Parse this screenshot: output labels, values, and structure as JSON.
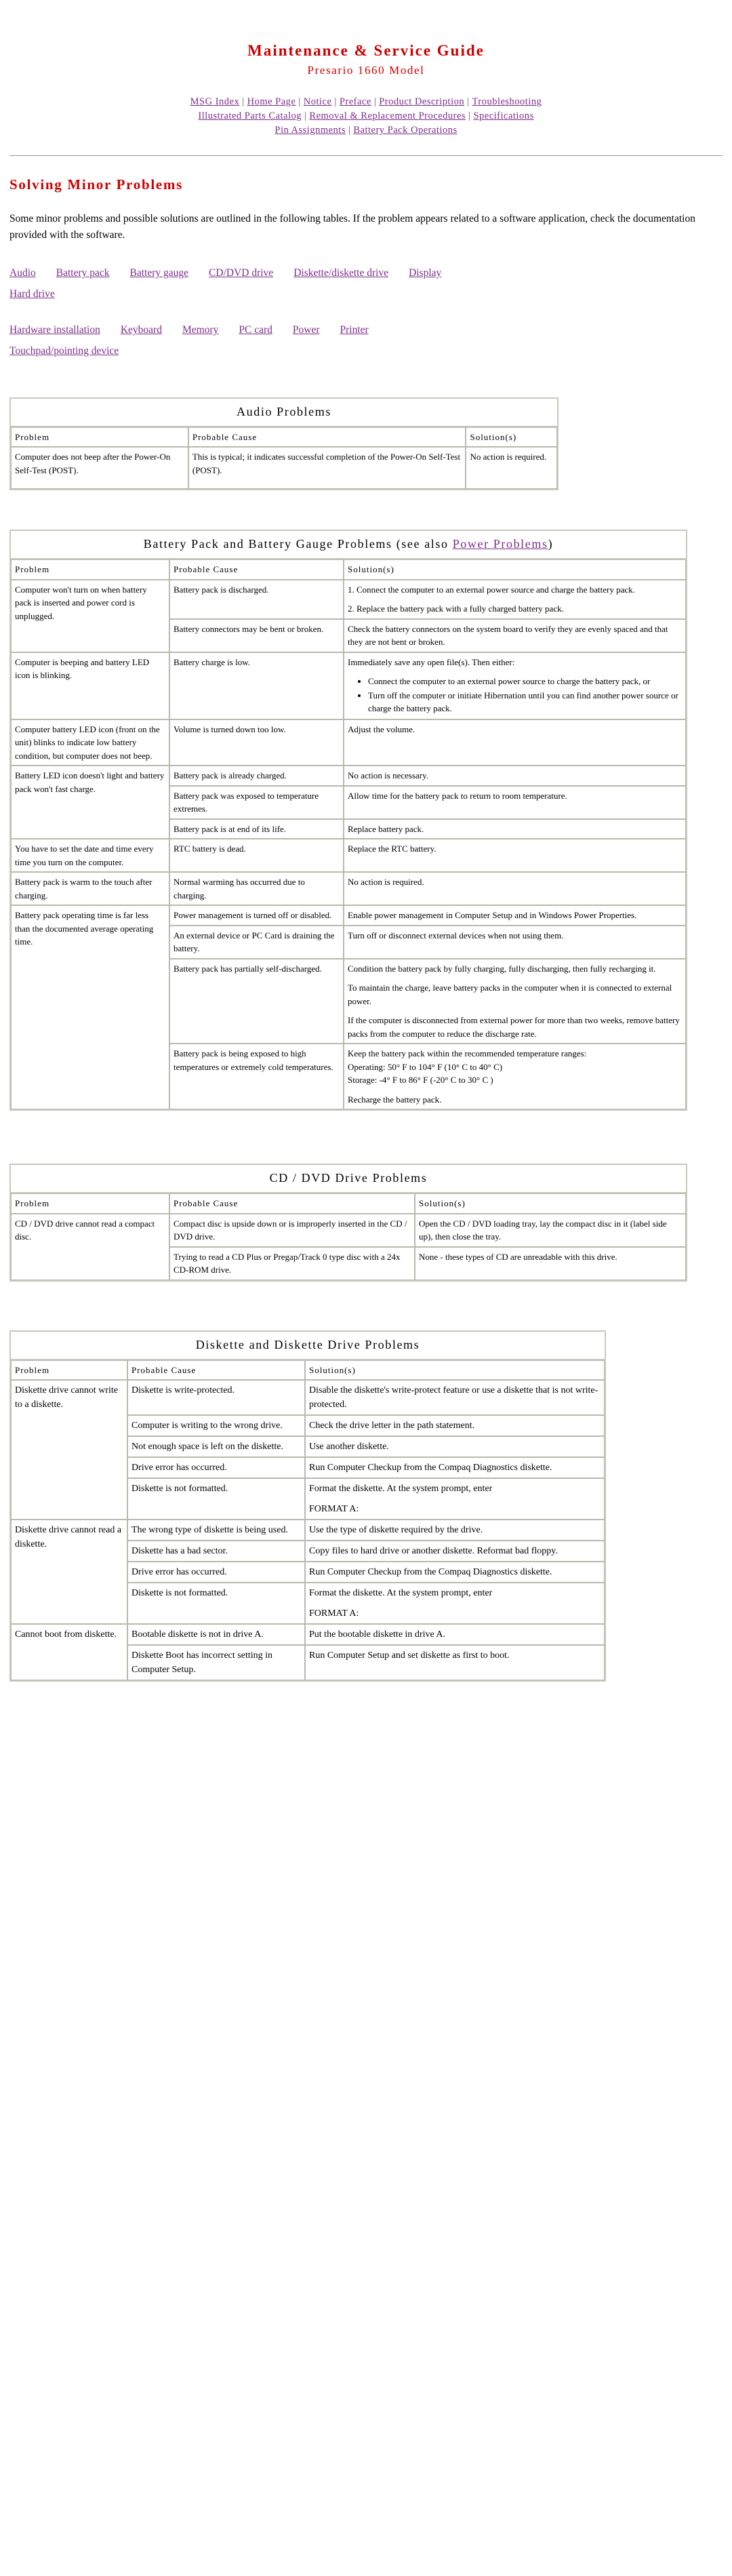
{
  "header": {
    "title": "Maintenance & Service Guide",
    "subtitle": "Presario 1660 Model",
    "nav_line1": [
      {
        "label": "MSG Index"
      },
      {
        "label": "Home Page"
      },
      {
        "label": "Notice"
      },
      {
        "label": "Preface"
      },
      {
        "label": "Product Description"
      },
      {
        "label": "Troubleshooting"
      }
    ],
    "nav_line2": [
      {
        "label": "Illustrated Parts Catalog"
      },
      {
        "label": "Removal & Replacement Procedures"
      },
      {
        "label": "Specifications"
      }
    ],
    "nav_line3": [
      {
        "label": "Pin Assignments"
      },
      {
        "label": "Battery Pack Operations"
      }
    ],
    "separator": "|"
  },
  "section": {
    "heading": "Solving Minor Problems",
    "intro": "Some minor problems and possible solutions are outlined in the following tables. If the problem appears related to a software application, check the documentation provided with the software.",
    "topics_row1": [
      "Audio",
      "Battery pack",
      "Battery gauge",
      "CD/DVD drive",
      "Diskette/diskette drive",
      "Display"
    ],
    "topics_row2": [
      "Hard drive"
    ],
    "topics_row3": [
      "Hardware installation",
      "Keyboard",
      "Memory",
      "PC card",
      "Power",
      "Printer"
    ],
    "topics_row4": [
      "Touchpad/pointing device"
    ]
  },
  "columns": {
    "problem": "Problem",
    "cause": "Probable Cause",
    "solution": "Solution(s)"
  },
  "audio_table": {
    "caption": "Audio Problems",
    "rows": [
      {
        "problem": "Computer does not beep after the Power-On Self-Test (POST).",
        "cause": "This is typical; it indicates successful completion of the Power-On Self-Test (POST).",
        "solution": "No action is required."
      }
    ]
  },
  "battery_table": {
    "caption_pre": "Battery Pack and Battery Gauge Problems (see also ",
    "caption_link": "Power Problems",
    "caption_post": ")",
    "groups": [
      {
        "problem": "Computer won't turn on when battery pack is inserted and power cord is unplugged.",
        "rows": [
          {
            "cause": "Battery pack is discharged.",
            "solution_paras": [
              "1. Connect the computer to an external power source and charge the battery pack.",
              "2. Replace the battery pack with a fully charged battery pack."
            ]
          },
          {
            "cause": "Battery connectors may be bent or broken.",
            "solution_paras": [
              "Check the battery connectors on the system board to verify they are evenly spaced and that they are not bent or broken."
            ]
          }
        ]
      },
      {
        "problem": "Computer is beeping and battery LED icon is blinking.",
        "rows": [
          {
            "cause": "Battery charge is low.",
            "solution_paras": [
              "Immediately save any open file(s). Then either:"
            ],
            "solution_bullets": [
              "Connect the computer to an external power source to charge the battery pack, or",
              "Turn off the computer or initiate Hibernation until you can find another power source or charge the battery pack."
            ]
          }
        ]
      },
      {
        "problem": "Computer battery LED icon (front on the unit) blinks to indicate low battery condition, but computer does not beep.",
        "rows": [
          {
            "cause": "Volume is turned down too low.",
            "solution_paras": [
              "Adjust the volume."
            ]
          }
        ]
      },
      {
        "problem": "Battery LED icon doesn't light and battery pack won't fast charge.",
        "rows": [
          {
            "cause": "Battery pack is already charged.",
            "solution_paras": [
              "No action is necessary."
            ]
          },
          {
            "cause": "Battery pack was exposed to temperature extremes.",
            "solution_paras": [
              "Allow time for the battery pack to return to room temperature."
            ]
          },
          {
            "cause": "Battery pack is at end of its life.",
            "solution_paras": [
              "Replace battery pack."
            ]
          }
        ]
      },
      {
        "problem": "You have to set the date and time every time you turn on the computer.",
        "rows": [
          {
            "cause": "RTC battery is dead.",
            "solution_paras": [
              "Replace the RTC battery."
            ]
          }
        ]
      },
      {
        "problem": "Battery pack is warm to the touch after charging.",
        "rows": [
          {
            "cause": "Normal warming has occurred due to charging.",
            "solution_paras": [
              "No action is required."
            ]
          }
        ]
      },
      {
        "problem": "Battery pack operating time is far less than the documented average operating time.",
        "rows": [
          {
            "cause": "Power management is turned off or disabled.",
            "solution_paras": [
              "Enable power management in Computer Setup and in Windows Power Properties."
            ]
          },
          {
            "cause": "An external device or PC Card is draining the battery.",
            "solution_paras": [
              "Turn off or disconnect external devices when not using them."
            ]
          },
          {
            "cause": "Battery pack has partially self-discharged.",
            "solution_paras": [
              "Condition the battery pack by fully charging, fully discharging, then fully recharging it.",
              "To maintain the charge, leave battery packs in the computer when it is connected to external power.",
              "If the computer is disconnected from external power for more than two weeks, remove battery packs from the computer to reduce the discharge rate."
            ]
          },
          {
            "cause": "Battery pack is being exposed to high temperatures or extremely cold temperatures.",
            "solution_paras": [
              "Keep the battery pack within the recommended temperature ranges:",
              "Operating: 50° F to 104° F (10° C to 40° C)",
              "Storage: -4° F to 86° F (-20° C to 30° C )",
              "Recharge the battery pack."
            ]
          }
        ]
      }
    ]
  },
  "cddvd_table": {
    "caption": "CD / DVD Drive Problems",
    "groups": [
      {
        "problem": "CD / DVD drive cannot read a compact disc.",
        "rows": [
          {
            "cause": "Compact disc is upside down or is improperly inserted in the CD / DVD drive.",
            "solution": "Open the CD / DVD loading tray, lay the compact disc in it (label side up), then close the tray."
          },
          {
            "cause": "Trying to read a CD Plus or Pregap/Track 0 type disc with a 24x CD-ROM drive.",
            "solution": "None - these types of CD are unreadable with this drive."
          }
        ]
      }
    ]
  },
  "diskette_table": {
    "caption": "Diskette and Diskette Drive Problems",
    "groups": [
      {
        "problem": "Diskette drive cannot write to a diskette.",
        "rows": [
          {
            "cause": "Diskette is write-protected.",
            "solution_paras": [
              "Disable the diskette's write-protect feature or use a diskette that is not write-protected."
            ]
          },
          {
            "cause": "Computer is writing to the wrong drive.",
            "solution_paras": [
              "Check the drive letter in the path statement."
            ]
          },
          {
            "cause": "Not enough space is left on the diskette.",
            "solution_paras": [
              "Use another diskette."
            ]
          },
          {
            "cause": "Drive error has occurred.",
            "solution_paras": [
              "Run Computer Checkup from the Compaq Diagnostics diskette."
            ]
          },
          {
            "cause": "Diskette is not formatted.",
            "solution_paras": [
              "Format the diskette. At the system prompt, enter",
              "FORMAT A:"
            ]
          }
        ]
      },
      {
        "problem": "Diskette drive cannot read a diskette.",
        "rows": [
          {
            "cause": "The wrong type of diskette is being used.",
            "solution_paras": [
              "Use the type of diskette required by the drive."
            ]
          },
          {
            "cause": "Diskette has a bad sector.",
            "solution_paras": [
              "Copy files to hard drive or another diskette. Reformat bad floppy."
            ]
          },
          {
            "cause": "Drive error has occurred.",
            "solution_paras": [
              "Run Computer Checkup from the Compaq Diagnostics diskette."
            ]
          },
          {
            "cause": "Diskette is not formatted.",
            "solution_paras": [
              "Format the diskette. At the system prompt, enter",
              "FORMAT A:"
            ]
          }
        ]
      },
      {
        "problem": "Cannot boot from diskette.",
        "rows": [
          {
            "cause": "Bootable diskette is not in drive A.",
            "solution_paras": [
              "Put the bootable diskette in drive A."
            ]
          },
          {
            "cause": "Diskette Boot has incorrect setting in Computer Setup.",
            "solution_paras": [
              "Run Computer Setup and set diskette as first to boot."
            ]
          }
        ]
      }
    ]
  },
  "colors": {
    "title_red": "#cc0000",
    "link_purple": "#7c2d8b",
    "table_border": "#c8c8c0"
  }
}
